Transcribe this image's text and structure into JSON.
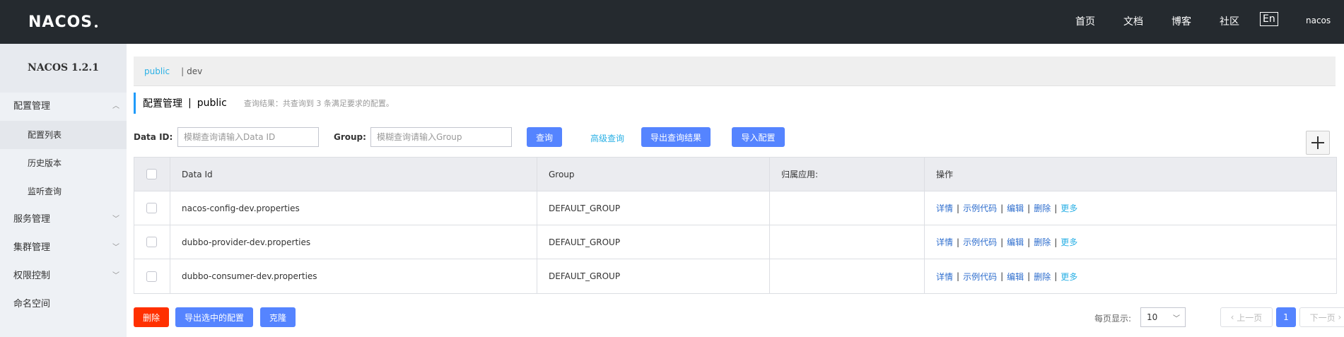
{
  "header": {
    "logo": "NACOS",
    "nav": {
      "home": "首页",
      "docs": "文档",
      "blog": "博客",
      "community": "社区"
    },
    "lang": "En",
    "user": "nacos"
  },
  "sidebar": {
    "version": "NACOS 1.2.1",
    "items": [
      {
        "label": "配置管理"
      },
      {
        "label": "配置列表"
      },
      {
        "label": "历史版本"
      },
      {
        "label": "监听查询"
      },
      {
        "label": "服务管理"
      },
      {
        "label": "集群管理"
      },
      {
        "label": "权限控制"
      },
      {
        "label": "命名空间"
      }
    ]
  },
  "namespace_bar": {
    "public": "public",
    "sep": "|",
    "dev": "dev"
  },
  "title": {
    "main": "配置管理",
    "pipe": "|",
    "namespace": "public",
    "result": "查询结果：共查询到 3 条满足要求的配置。"
  },
  "search": {
    "dataid_label": "Data ID:",
    "dataid_placeholder": "模糊查询请输入Data ID",
    "group_label": "Group:",
    "group_placeholder": "模糊查询请输入Group",
    "query_button": "查询",
    "advanced_link": "高级查询",
    "export_button": "导出查询结果",
    "import_button": "导入配置"
  },
  "table": {
    "headers": {
      "data_id": "Data Id",
      "group": "Group",
      "app": "归属应用:",
      "ops": "操作"
    },
    "rows": [
      {
        "data_id": "nacos-config-dev.properties",
        "group": "DEFAULT_GROUP",
        "app": ""
      },
      {
        "data_id": "dubbo-provider-dev.properties",
        "group": "DEFAULT_GROUP",
        "app": ""
      },
      {
        "data_id": "dubbo-consumer-dev.properties",
        "group": "DEFAULT_GROUP",
        "app": ""
      }
    ],
    "ops": {
      "detail": "详情",
      "sample": "示例代码",
      "edit": "编辑",
      "delete": "删除",
      "more": "更多",
      "sep": "|"
    }
  },
  "footer": {
    "delete_button": "删除",
    "export_selected_button": "导出选中的配置",
    "clone_button": "克隆",
    "page_size_label": "每页显示:",
    "page_size": "10",
    "prev": "上一页",
    "current_page": "1",
    "next": "下一页"
  },
  "colors": {
    "header_bg": "#252a2f",
    "primary": "#5584ff",
    "danger": "#ff3000",
    "link": "#2ab0e5"
  }
}
